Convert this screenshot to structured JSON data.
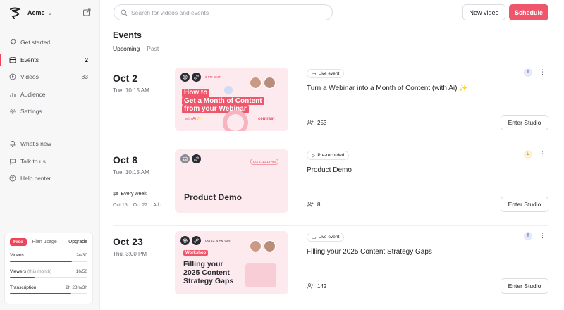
{
  "brand": {
    "name": "Acme"
  },
  "search": {
    "placeholder": "Search for videos and events"
  },
  "header": {
    "new_video_label": "New video",
    "schedule_label": "Schedule"
  },
  "nav": [
    {
      "label": "Get started",
      "count": "",
      "icon": "rocket-icon"
    },
    {
      "label": "Events",
      "count": "2",
      "icon": "calendar-icon"
    },
    {
      "label": "Videos",
      "count": "83",
      "icon": "play-icon"
    },
    {
      "label": "Audience",
      "count": "",
      "icon": "bar-chart-icon"
    },
    {
      "label": "Settings",
      "count": "",
      "icon": "gear-icon"
    }
  ],
  "nav_secondary": [
    {
      "label": "What's new",
      "icon": "bell-icon"
    },
    {
      "label": "Talk to us",
      "icon": "chat-icon"
    },
    {
      "label": "Help center",
      "icon": "help-icon"
    }
  ],
  "plan": {
    "badge": "Free",
    "label": "Plan usage",
    "upgrade": "Upgrade",
    "usage": [
      {
        "name": "Videos",
        "qualifier": "",
        "value": "24/30",
        "fraction": 0.8
      },
      {
        "name": "Viewers",
        "qualifier": "(this month)",
        "value": "16/50",
        "fraction": 0.32
      },
      {
        "name": "Transcription",
        "qualifier": "",
        "value": "2h 23m/3h",
        "fraction": 0.79
      }
    ]
  },
  "page": {
    "title": "Events",
    "tabs": [
      "Upcoming",
      "Past"
    ]
  },
  "events": [
    {
      "date": "Oct 2",
      "time": "Tue, 10:15 AM",
      "type": "Live event",
      "title": "Turn a Webinar into a Month of Content (with Ai) ✨",
      "attendees": "253",
      "host_initial": "T",
      "enter_label": "Enter Studio",
      "thumb": {
        "tag": "3 PM GMT",
        "headline_1": "How to",
        "headline_2": "Get a Month of Content",
        "headline_3": "from your Webinar",
        "sub": "with Ai ✨",
        "brand": "centrast"
      }
    },
    {
      "date": "Oct 8",
      "time": "Tue, 10:15 AM",
      "type": "Pre-recorded",
      "title": "Product Demo",
      "attendees": "8",
      "host_initial": "L",
      "enter_label": "Enter Studio",
      "recurrence": "Every week",
      "occurrences": [
        "Oct 15",
        "Oct 22",
        "All ›"
      ],
      "thumb": {
        "tag": "Oct 8, 10:15 AM",
        "headline_1": "Product Demo"
      }
    },
    {
      "date": "Oct 23",
      "time": "Thu, 3:00 PM",
      "type": "Live event",
      "title": "Filling your 2025 Content Strategy Gaps",
      "attendees": "142",
      "host_initial": "T",
      "enter_label": "Enter Studio",
      "thumb": {
        "tag": "Oct 23, 4 PM GMT",
        "badge": "Workshop",
        "headline_1": "Filling your",
        "headline_2": "2025 Content",
        "headline_3": "Strategy Gaps"
      }
    }
  ],
  "colors": {
    "accent": "#f0566b",
    "sidebar_bg": "#f7f7f8",
    "thumb_bg": "#fdeaee"
  }
}
